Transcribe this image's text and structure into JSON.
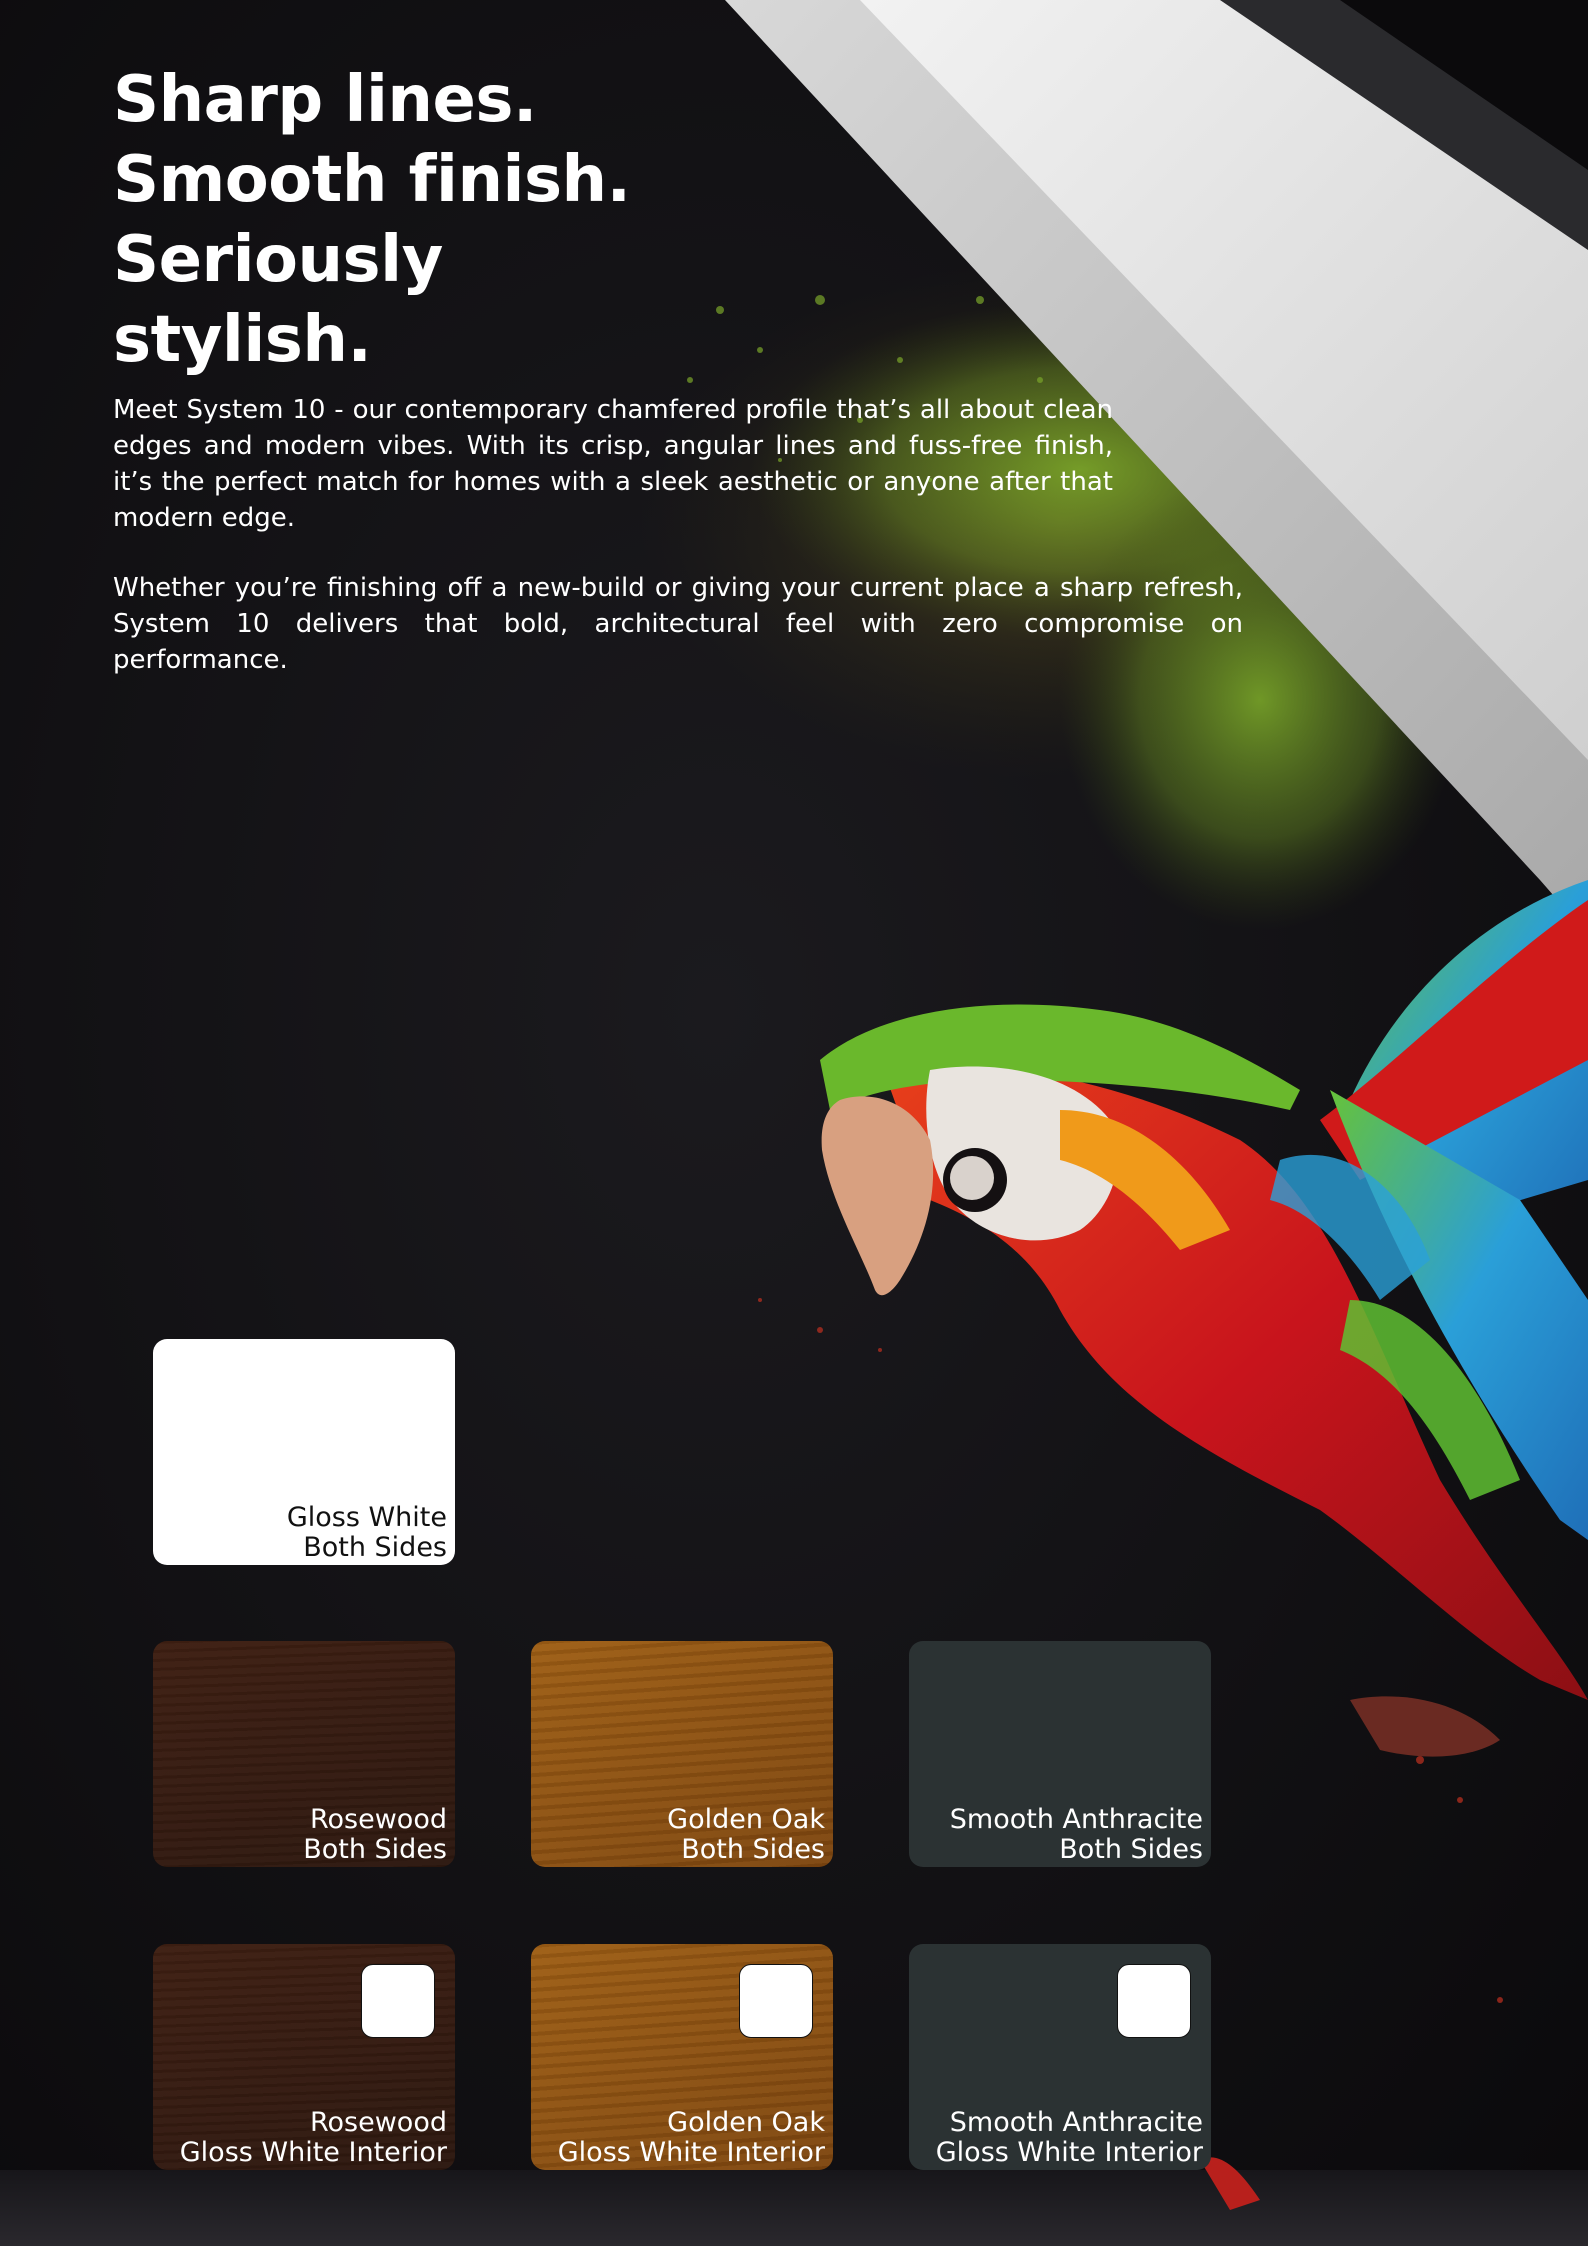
{
  "headline": [
    "Sharp lines.",
    "Smooth finish.",
    "Seriously",
    "stylish."
  ],
  "paragraphs": [
    "Meet System 10 - our contemporary chamfered profile that’s all about clean edges and modern vibes. With its crisp, angular lines and fuss-free finish, it’s the perfect match for homes with a sleek aesthetic or anyone after that modern edge.",
    "Whether you’re finishing off a new-build or giving your current place a sharp refresh, System 10 delivers that bold, architectural feel with zero compromise on performance."
  ],
  "swatches": [
    {
      "name": "Gloss White",
      "sides": "Both Sides",
      "color": "#ffffff"
    },
    {
      "name": "Rosewood",
      "sides": "Both Sides",
      "color": "#3a1d12"
    },
    {
      "name": "Golden Oak",
      "sides": "Both Sides",
      "color": "#8d5213"
    },
    {
      "name": "Smooth Anthracite",
      "sides": "Both Sides",
      "color": "#2b3233"
    },
    {
      "name": "Rosewood",
      "sides": "Gloss White Interior",
      "color": "#3a1d12"
    },
    {
      "name": "Golden Oak",
      "sides": "Gloss White Interior",
      "color": "#8d5213"
    },
    {
      "name": "Smooth Anthracite",
      "sides": "Gloss White Interior",
      "color": "#2b3233"
    }
  ]
}
